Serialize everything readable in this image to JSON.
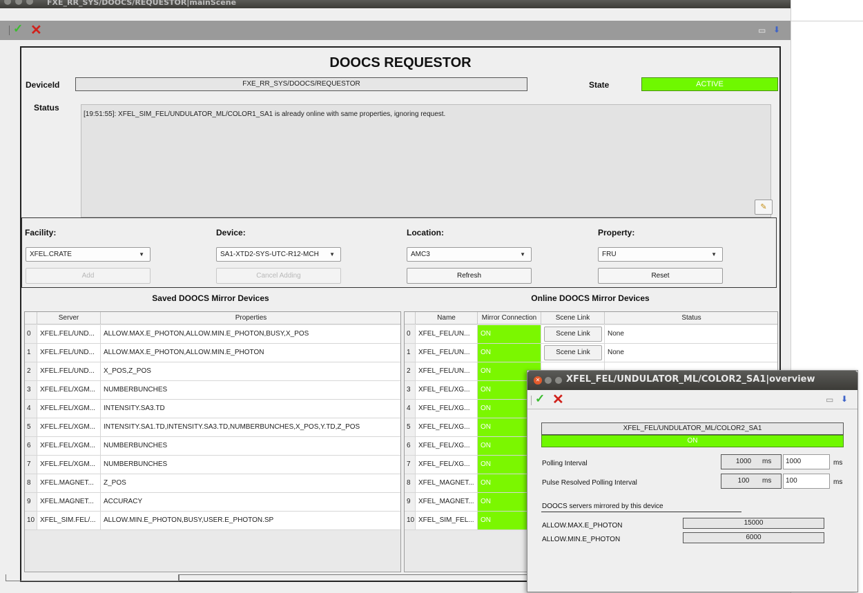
{
  "main_window": {
    "title": "FXE_RR_SYS/DOOCS/REQUESTOR|mainScene"
  },
  "scene": {
    "heading": "DOOCS REQUESTOR",
    "device_id_label": "DeviceId",
    "device_id_value": "FXE_RR_SYS/DOOCS/REQUESTOR",
    "state_label": "State",
    "state_value": "ACTIVE",
    "status_label": "Status",
    "status_text": "[19:51:55]: XFEL_SIM_FEL/UNDULATOR_ML/COLOR1_SA1 is already online with same properties, ignoring request."
  },
  "filters": {
    "facility": {
      "label": "Facility:",
      "value": "XFEL.CRATE"
    },
    "device": {
      "label": "Device:",
      "value": "SA1-XTD2-SYS-UTC-R12-MCH"
    },
    "location": {
      "label": "Location:",
      "value": "AMC3"
    },
    "property": {
      "label": "Property:",
      "value": "FRU"
    },
    "add_label": "Add",
    "cancel_label": "Cancel Adding",
    "refresh_label": "Refresh",
    "reset_label": "Reset"
  },
  "saved": {
    "title": "Saved DOOCS Mirror Devices",
    "headers": [
      "Server",
      "Properties"
    ],
    "rows": [
      [
        "0",
        "XFEL.FEL/UND...",
        "ALLOW.MAX.E_PHOTON,ALLOW.MIN.E_PHOTON,BUSY,X_POS"
      ],
      [
        "1",
        "XFEL.FEL/UND...",
        "ALLOW.MAX.E_PHOTON,ALLOW.MIN.E_PHOTON"
      ],
      [
        "2",
        "XFEL.FEL/UND...",
        "X_POS,Z_POS"
      ],
      [
        "3",
        "XFEL.FEL/XGM...",
        "NUMBERBUNCHES"
      ],
      [
        "4",
        "XFEL.FEL/XGM...",
        "INTENSITY.SA3.TD"
      ],
      [
        "5",
        "XFEL.FEL/XGM...",
        "INTENSITY.SA1.TD,INTENSITY.SA3.TD,NUMBERBUNCHES,X_POS,Y.TD,Z_POS"
      ],
      [
        "6",
        "XFEL.FEL/XGM...",
        "NUMBERBUNCHES"
      ],
      [
        "7",
        "XFEL.FEL/XGM...",
        "NUMBERBUNCHES"
      ],
      [
        "8",
        "XFEL.MAGNET...",
        "Z_POS"
      ],
      [
        "9",
        "XFEL.MAGNET...",
        "ACCURACY"
      ],
      [
        "10",
        "XFEL_SIM.FEL/...",
        "ALLOW.MIN.E_PHOTON,BUSY,USER.E_PHOTON.SP"
      ]
    ]
  },
  "online": {
    "title": "Online DOOCS Mirror Devices",
    "headers": [
      "Name",
      "Mirror Connection",
      "Scene Link",
      "Status"
    ],
    "rows": [
      [
        "0",
        "XFEL_FEL/UN...",
        "ON",
        "Scene Link",
        "None"
      ],
      [
        "1",
        "XFEL_FEL/UN...",
        "ON",
        "Scene Link",
        "None"
      ],
      [
        "2",
        "XFEL_FEL/UN...",
        "ON",
        "",
        ""
      ],
      [
        "3",
        "XFEL_FEL/XG...",
        "ON",
        "",
        ""
      ],
      [
        "4",
        "XFEL_FEL/XG...",
        "ON",
        "",
        ""
      ],
      [
        "5",
        "XFEL_FEL/XG...",
        "ON",
        "",
        ""
      ],
      [
        "6",
        "XFEL_FEL/XG...",
        "ON",
        "",
        ""
      ],
      [
        "7",
        "XFEL_FEL/XG...",
        "ON",
        "",
        ""
      ],
      [
        "8",
        "XFEL_MAGNET...",
        "ON",
        "",
        ""
      ],
      [
        "9",
        "XFEL_MAGNET...",
        "ON",
        "",
        ""
      ],
      [
        "10",
        "XFEL_SIM_FEL...",
        "ON",
        "",
        ""
      ]
    ]
  },
  "popup": {
    "title": "XFEL_FEL/UNDULATOR_ML/COLOR2_SA1|overview",
    "device_name": "XFEL_FEL/UNDULATOR_ML/COLOR2_SA1",
    "connection": "ON",
    "polling_label": "Polling Interval",
    "polling_value": "1000",
    "polling_input": "1000",
    "pulse_label": "Pulse Resolved Polling Interval",
    "pulse_value": "100",
    "pulse_input": "100",
    "unit": "ms",
    "mirrored_label": "DOOCS servers mirrored by this device",
    "properties": [
      {
        "name": "ALLOW.MAX.E_PHOTON",
        "value": "15000"
      },
      {
        "name": "ALLOW.MIN.E_PHOTON",
        "value": "6000"
      }
    ]
  },
  "colors": {
    "on_green": "#7bf700",
    "active_green": "#6ff800",
    "cross_red": "#d0211b",
    "check_green": "#3bbd2f"
  },
  "icons": [
    "check-icon",
    "cross-icon",
    "print-icon",
    "download-icon",
    "broom-icon",
    "dropdown-arrow-icon",
    "close-icon"
  ]
}
